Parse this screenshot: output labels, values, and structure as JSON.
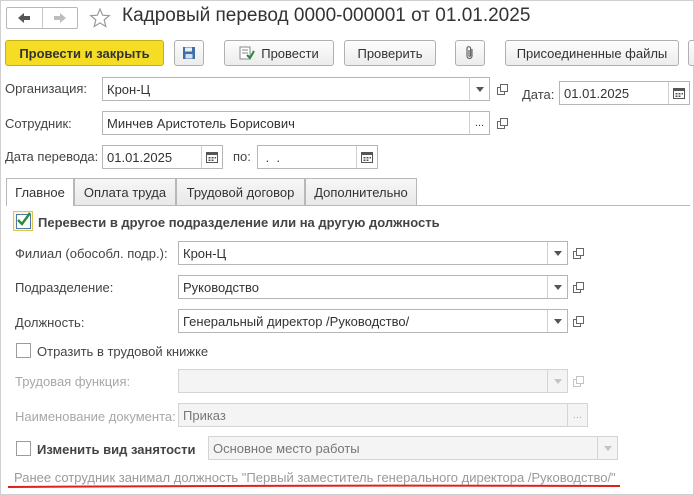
{
  "window": {
    "title": "Кадровый перевод 0000-000001 от 01.01.2025"
  },
  "nav": {
    "back_icon": "arrow-left-icon",
    "forward_icon": "arrow-right-icon",
    "favorite_icon": "star-icon"
  },
  "toolbar": {
    "post_and_close": "Провести и закрыть",
    "save_icon": "floppy-disk-icon",
    "post": "Провести",
    "check": "Проверить",
    "attach_icon": "paperclip-icon",
    "attached_files": "Присоединенные файлы"
  },
  "header": {
    "organization_label": "Организация:",
    "organization_value": "Крон-Ц",
    "date_label": "Дата:",
    "date_value": "01.01.2025",
    "employee_label": "Сотрудник:",
    "employee_value": "Минчев Аристотель Борисович",
    "transfer_date_label": "Дата перевода:",
    "transfer_date_value": "01.01.2025",
    "to_label": "по:",
    "to_value": " .  ."
  },
  "tabs": [
    {
      "label": "Главное",
      "active": true
    },
    {
      "label": "Оплата труда",
      "active": false
    },
    {
      "label": "Трудовой договор",
      "active": false
    },
    {
      "label": "Дополнительно",
      "active": false
    }
  ],
  "main": {
    "transfer_checkbox_label": "Перевести в другое подразделение или на другую должность",
    "transfer_checked": true,
    "branch_label": "Филиал (обособл. подр.):",
    "branch_value": "Крон-Ц",
    "department_label": "Подразделение:",
    "department_value": "Руководство",
    "position_label": "Должность:",
    "position_value": "Генеральный директор /Руководство/",
    "workbook_checkbox_label": "Отразить в трудовой книжке",
    "workbook_checked": false,
    "labor_function_label": "Трудовая функция:",
    "labor_function_value": "",
    "document_name_label": "Наименование документа:",
    "document_name_value": "Приказ",
    "employment_checkbox_label": "Изменить вид занятости",
    "employment_checked": false,
    "employment_value": "Основное место работы",
    "previous_position_note": "Ранее сотрудник занимал должность \"Первый заместитель генерального директора /Руководство/\""
  },
  "colors": {
    "primary_button": "#f6dd25",
    "highlight_underline": "#e0201a",
    "check_mark": "#2a8a3a"
  }
}
